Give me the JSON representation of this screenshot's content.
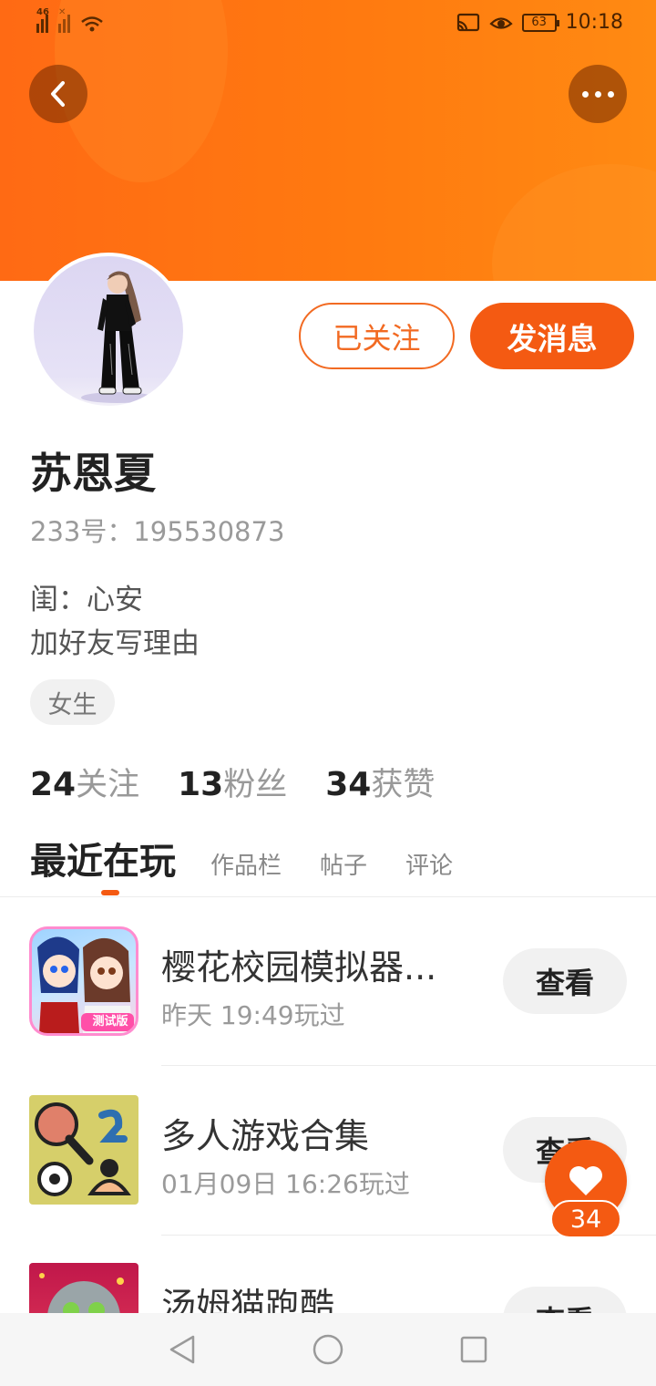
{
  "status_bar": {
    "network_1": "46",
    "network_2": "✕",
    "battery": "63",
    "time": "10:18"
  },
  "header": {
    "back_icon": "chevron-left-icon",
    "more_icon": "more-horizontal-icon"
  },
  "profile": {
    "name": "苏恩夏",
    "id_line": "233号：195530873",
    "bio_line1": "闺：心安",
    "bio_line2": "加好友写理由",
    "gender_tag": "女生",
    "follow_label": "已关注",
    "message_label": "发消息"
  },
  "stats": [
    {
      "count": "24",
      "label": "关注"
    },
    {
      "count": "13",
      "label": "粉丝"
    },
    {
      "count": "34",
      "label": "获赞"
    }
  ],
  "tabs": {
    "active": "最近在玩",
    "items": [
      "作品栏",
      "帖子",
      "评论"
    ]
  },
  "games": [
    {
      "title": "樱花校园模拟器...",
      "time": "昨天 19:49玩过",
      "button": "查看",
      "icon_badge": "测试版"
    },
    {
      "title": "多人游戏合集",
      "time": "01月09日 16:26玩过",
      "button": "查看"
    },
    {
      "title": "汤姆猫跑酷",
      "time": "",
      "button": "查看"
    }
  ],
  "like_fab": {
    "count": "34",
    "icon": "heart-icon"
  },
  "nav": {
    "back_icon": "nav-back-icon",
    "home_icon": "nav-home-icon",
    "recents_icon": "nav-recents-icon"
  },
  "colors": {
    "accent": "#f45a12",
    "banner": "#ff7a10"
  }
}
